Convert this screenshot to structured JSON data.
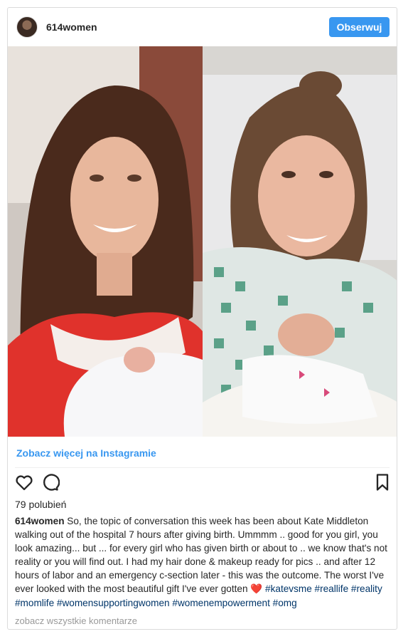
{
  "post": {
    "username": "614women",
    "follow_label": "Obserwuj",
    "view_more_label": "Zobacz więcej na Instagramie",
    "likes_label": "79 polubień",
    "caption_user": "614women",
    "caption_text": "So, the topic of conversation this week has been about Kate Middleton walking out of the hospital 7 hours after giving birth. Ummmm .. good for you girl, you look amazing... but ... for every girl who has given birth or about to .. we know that's not reality or you will find out. I had my hair done & makeup ready for pics .. and after 12 hours of labor and an emergency c-section later - this was the outcome. The worst I've ever looked with the most beautiful gift I've ever gotten",
    "caption_emoji": "❤️",
    "hashtags": "#katevsme #reallife #reality #momlife #womensupportingwomen #womenempowerment #omg",
    "comments_label": "zobacz wszystkie komentarze"
  },
  "icons": {
    "like": "heart-outline-icon",
    "comment": "speech-bubble-icon",
    "save": "bookmark-icon"
  },
  "colors": {
    "accent": "#3897f0",
    "link": "#3897f0",
    "hashtag": "#003569",
    "text": "#262626",
    "muted": "#999999",
    "border": "#dbdbdb"
  }
}
